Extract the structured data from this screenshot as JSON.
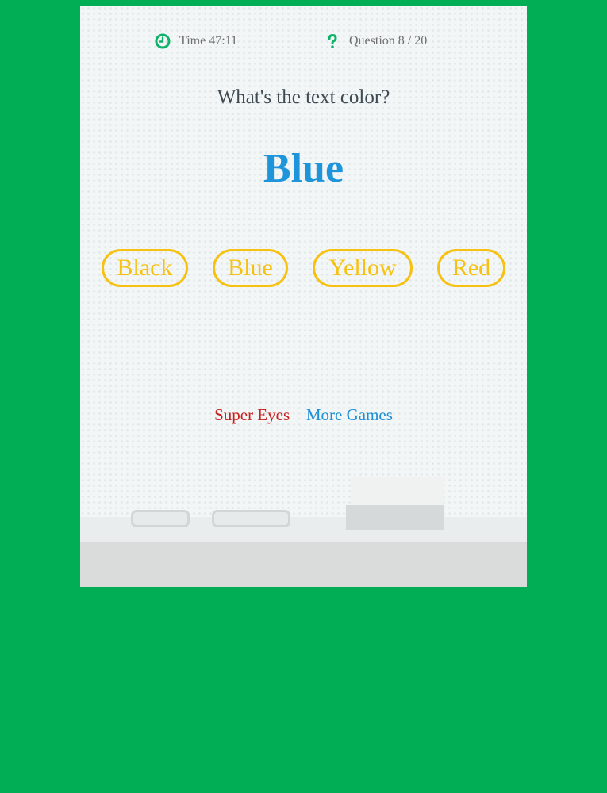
{
  "status": {
    "time_label": "Time 47:11",
    "question_label": "Question 8 / 20",
    "time_icon": "clock-icon",
    "question_icon": "question-mark-icon"
  },
  "prompt": "What's the text color?",
  "color_word": {
    "text": "Blue",
    "display_color": "#1e95da"
  },
  "answers": [
    "Black",
    "Blue",
    "Yellow",
    "Red"
  ],
  "footer": {
    "super_eyes": "Super Eyes",
    "separator": "|",
    "more_games": "More Games"
  },
  "colors": {
    "background": "#02ae55",
    "accent_yellow": "#f6c110",
    "icon_green": "#10b26a",
    "link_red": "#c8201e",
    "link_blue": "#1c8fd7"
  }
}
